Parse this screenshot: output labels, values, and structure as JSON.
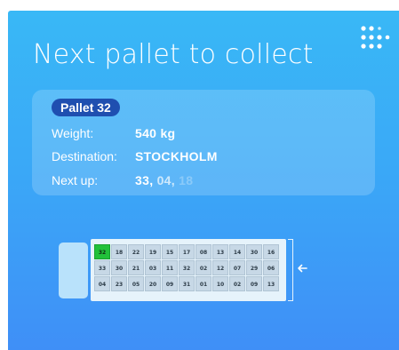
{
  "header": {
    "title": "Next pallet to collect",
    "logo_icon": "dot-grid-logo-icon"
  },
  "info": {
    "pallet_badge": "Pallet 32",
    "weight_label": "Weight:",
    "weight_value": "540 kg",
    "destination_label": "Destination:",
    "destination_value": "STOCKHOLM",
    "next_up_label": "Next up:",
    "next_up_values": [
      "33",
      "04",
      "18"
    ]
  },
  "truck": {
    "rows": [
      [
        "32",
        "18",
        "22",
        "19",
        "15",
        "17",
        "08",
        "13",
        "14",
        "30",
        "16"
      ],
      [
        "33",
        "30",
        "21",
        "03",
        "11",
        "32",
        "02",
        "12",
        "07",
        "29",
        "06"
      ],
      [
        "04",
        "23",
        "05",
        "20",
        "09",
        "31",
        "01",
        "10",
        "02",
        "09",
        "13"
      ]
    ],
    "active_cell": "32",
    "door_icon": "arrow-left-icon"
  },
  "colors": {
    "card_gradient_top": "#39b8f6",
    "card_gradient_bottom": "#3f8ff7",
    "badge_bg": "#1f4fb0",
    "active_cell": "#21c13a",
    "cell_bg": "#c7d8e6"
  }
}
